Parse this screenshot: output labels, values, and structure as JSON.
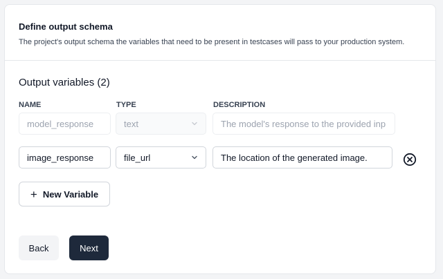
{
  "header": {
    "title": "Define output schema",
    "subtitle": "The project's output schema the variables that need to be present in testcases will pass to your production system."
  },
  "section": {
    "title": "Output variables (2)"
  },
  "columns": {
    "name": "NAME",
    "type": "TYPE",
    "description": "DESCRIPTION"
  },
  "rows": [
    {
      "name": "model_response",
      "type": "text",
      "description": "The model's response to the provided inp",
      "disabled": true
    },
    {
      "name": "image_response",
      "type": "file_url",
      "description": "The location of the generated image.",
      "disabled": false
    }
  ],
  "actions": {
    "new_variable": "New Variable",
    "back": "Back",
    "next": "Next"
  },
  "icons": {
    "chevron": "chevron-down-icon",
    "remove": "close-circle-icon",
    "plus": "plus-icon"
  }
}
